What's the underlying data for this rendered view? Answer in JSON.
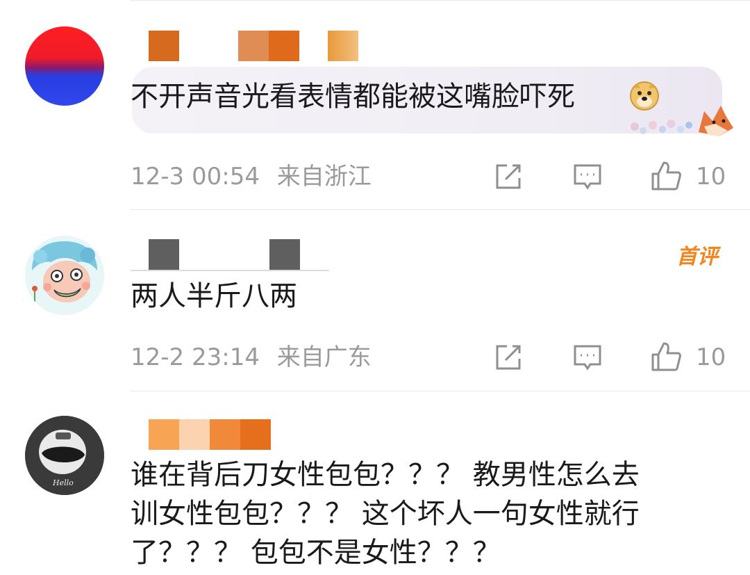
{
  "comments": [
    {
      "text": "不开声音光看表情都能被这嘴脸吓死",
      "time": "12-3 00:54",
      "location": "来自浙江",
      "likes": "10",
      "emoji": "doge-emoji",
      "decoration": "fox-flower-bubble-decoration"
    },
    {
      "text": "两人半斤八两",
      "time": "12-2 23:14",
      "location": "来自广东",
      "likes": "10",
      "badge": "首评"
    },
    {
      "lines": [
        "谁在背后刀女性包包？？？ 教男性怎么去",
        "训女性包包？？？ 这个坏人一句女性就行",
        "了？？？ 包包不是女性？？？"
      ]
    }
  ],
  "icons": {
    "share": "share-icon",
    "reply": "comment-icon",
    "like": "thumbs-up-icon"
  },
  "colors": {
    "meta_text": "#9a9a9a",
    "badge": "#f0861f",
    "divider": "#e8e8e8"
  }
}
